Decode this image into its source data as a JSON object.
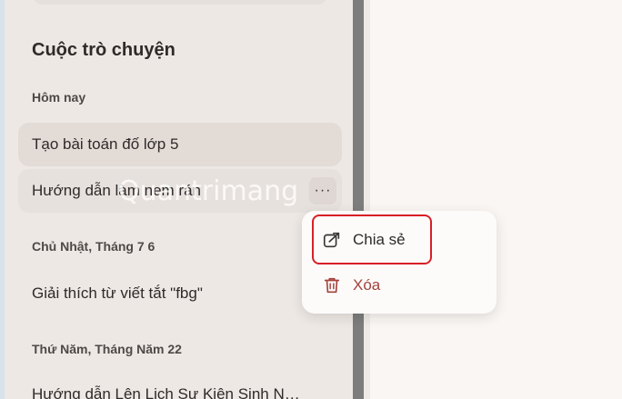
{
  "sidebar": {
    "section_title": "Cuộc trò chuyện",
    "groups": [
      {
        "label": "Hôm nay",
        "items": [
          {
            "title": "Tạo bài toán đố lớp 5"
          },
          {
            "title": "Hướng dẫn làm nem rán"
          }
        ]
      },
      {
        "label": "Chủ Nhật, Tháng 7 6",
        "items": [
          {
            "title": "Giải thích từ viết tắt \"fbg\""
          }
        ]
      },
      {
        "label": "Thứ Năm, Tháng Năm 22",
        "items": [
          {
            "title": "Hướng dẫn Lên Lịch Sự Kiện Sinh N…"
          }
        ]
      }
    ],
    "more_button_label": "···"
  },
  "context_menu": {
    "share_label": "Chia sẻ",
    "share_icon": "share-icon",
    "delete_label": "Xóa",
    "delete_icon": "trash-icon"
  },
  "watermark": "Quantrimang",
  "colors": {
    "highlight": "#d81f26",
    "delete_text": "#a4433c",
    "sidebar_bg": "#eee8e4"
  }
}
